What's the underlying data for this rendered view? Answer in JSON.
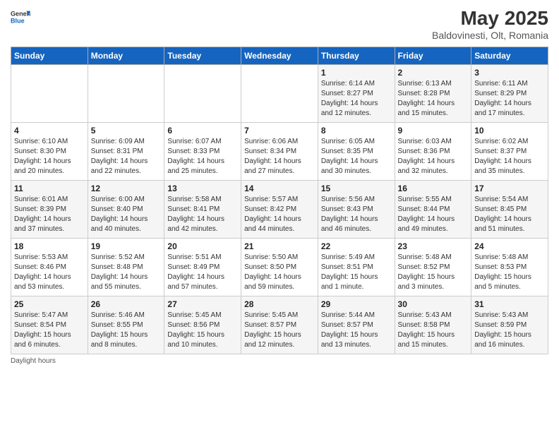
{
  "header": {
    "logo_general": "General",
    "logo_blue": "Blue",
    "title": "May 2025",
    "subtitle": "Baldovinesti, Olt, Romania"
  },
  "weekdays": [
    "Sunday",
    "Monday",
    "Tuesday",
    "Wednesday",
    "Thursday",
    "Friday",
    "Saturday"
  ],
  "weeks": [
    [
      {
        "day": "",
        "info": ""
      },
      {
        "day": "",
        "info": ""
      },
      {
        "day": "",
        "info": ""
      },
      {
        "day": "",
        "info": ""
      },
      {
        "day": "1",
        "info": "Sunrise: 6:14 AM\nSunset: 8:27 PM\nDaylight: 14 hours\nand 12 minutes."
      },
      {
        "day": "2",
        "info": "Sunrise: 6:13 AM\nSunset: 8:28 PM\nDaylight: 14 hours\nand 15 minutes."
      },
      {
        "day": "3",
        "info": "Sunrise: 6:11 AM\nSunset: 8:29 PM\nDaylight: 14 hours\nand 17 minutes."
      }
    ],
    [
      {
        "day": "4",
        "info": "Sunrise: 6:10 AM\nSunset: 8:30 PM\nDaylight: 14 hours\nand 20 minutes."
      },
      {
        "day": "5",
        "info": "Sunrise: 6:09 AM\nSunset: 8:31 PM\nDaylight: 14 hours\nand 22 minutes."
      },
      {
        "day": "6",
        "info": "Sunrise: 6:07 AM\nSunset: 8:33 PM\nDaylight: 14 hours\nand 25 minutes."
      },
      {
        "day": "7",
        "info": "Sunrise: 6:06 AM\nSunset: 8:34 PM\nDaylight: 14 hours\nand 27 minutes."
      },
      {
        "day": "8",
        "info": "Sunrise: 6:05 AM\nSunset: 8:35 PM\nDaylight: 14 hours\nand 30 minutes."
      },
      {
        "day": "9",
        "info": "Sunrise: 6:03 AM\nSunset: 8:36 PM\nDaylight: 14 hours\nand 32 minutes."
      },
      {
        "day": "10",
        "info": "Sunrise: 6:02 AM\nSunset: 8:37 PM\nDaylight: 14 hours\nand 35 minutes."
      }
    ],
    [
      {
        "day": "11",
        "info": "Sunrise: 6:01 AM\nSunset: 8:39 PM\nDaylight: 14 hours\nand 37 minutes."
      },
      {
        "day": "12",
        "info": "Sunrise: 6:00 AM\nSunset: 8:40 PM\nDaylight: 14 hours\nand 40 minutes."
      },
      {
        "day": "13",
        "info": "Sunrise: 5:58 AM\nSunset: 8:41 PM\nDaylight: 14 hours\nand 42 minutes."
      },
      {
        "day": "14",
        "info": "Sunrise: 5:57 AM\nSunset: 8:42 PM\nDaylight: 14 hours\nand 44 minutes."
      },
      {
        "day": "15",
        "info": "Sunrise: 5:56 AM\nSunset: 8:43 PM\nDaylight: 14 hours\nand 46 minutes."
      },
      {
        "day": "16",
        "info": "Sunrise: 5:55 AM\nSunset: 8:44 PM\nDaylight: 14 hours\nand 49 minutes."
      },
      {
        "day": "17",
        "info": "Sunrise: 5:54 AM\nSunset: 8:45 PM\nDaylight: 14 hours\nand 51 minutes."
      }
    ],
    [
      {
        "day": "18",
        "info": "Sunrise: 5:53 AM\nSunset: 8:46 PM\nDaylight: 14 hours\nand 53 minutes."
      },
      {
        "day": "19",
        "info": "Sunrise: 5:52 AM\nSunset: 8:48 PM\nDaylight: 14 hours\nand 55 minutes."
      },
      {
        "day": "20",
        "info": "Sunrise: 5:51 AM\nSunset: 8:49 PM\nDaylight: 14 hours\nand 57 minutes."
      },
      {
        "day": "21",
        "info": "Sunrise: 5:50 AM\nSunset: 8:50 PM\nDaylight: 14 hours\nand 59 minutes."
      },
      {
        "day": "22",
        "info": "Sunrise: 5:49 AM\nSunset: 8:51 PM\nDaylight: 15 hours\nand 1 minute."
      },
      {
        "day": "23",
        "info": "Sunrise: 5:48 AM\nSunset: 8:52 PM\nDaylight: 15 hours\nand 3 minutes."
      },
      {
        "day": "24",
        "info": "Sunrise: 5:48 AM\nSunset: 8:53 PM\nDaylight: 15 hours\nand 5 minutes."
      }
    ],
    [
      {
        "day": "25",
        "info": "Sunrise: 5:47 AM\nSunset: 8:54 PM\nDaylight: 15 hours\nand 6 minutes."
      },
      {
        "day": "26",
        "info": "Sunrise: 5:46 AM\nSunset: 8:55 PM\nDaylight: 15 hours\nand 8 minutes."
      },
      {
        "day": "27",
        "info": "Sunrise: 5:45 AM\nSunset: 8:56 PM\nDaylight: 15 hours\nand 10 minutes."
      },
      {
        "day": "28",
        "info": "Sunrise: 5:45 AM\nSunset: 8:57 PM\nDaylight: 15 hours\nand 12 minutes."
      },
      {
        "day": "29",
        "info": "Sunrise: 5:44 AM\nSunset: 8:57 PM\nDaylight: 15 hours\nand 13 minutes."
      },
      {
        "day": "30",
        "info": "Sunrise: 5:43 AM\nSunset: 8:58 PM\nDaylight: 15 hours\nand 15 minutes."
      },
      {
        "day": "31",
        "info": "Sunrise: 5:43 AM\nSunset: 8:59 PM\nDaylight: 15 hours\nand 16 minutes."
      }
    ]
  ],
  "footer": {
    "daylight_label": "Daylight hours"
  }
}
